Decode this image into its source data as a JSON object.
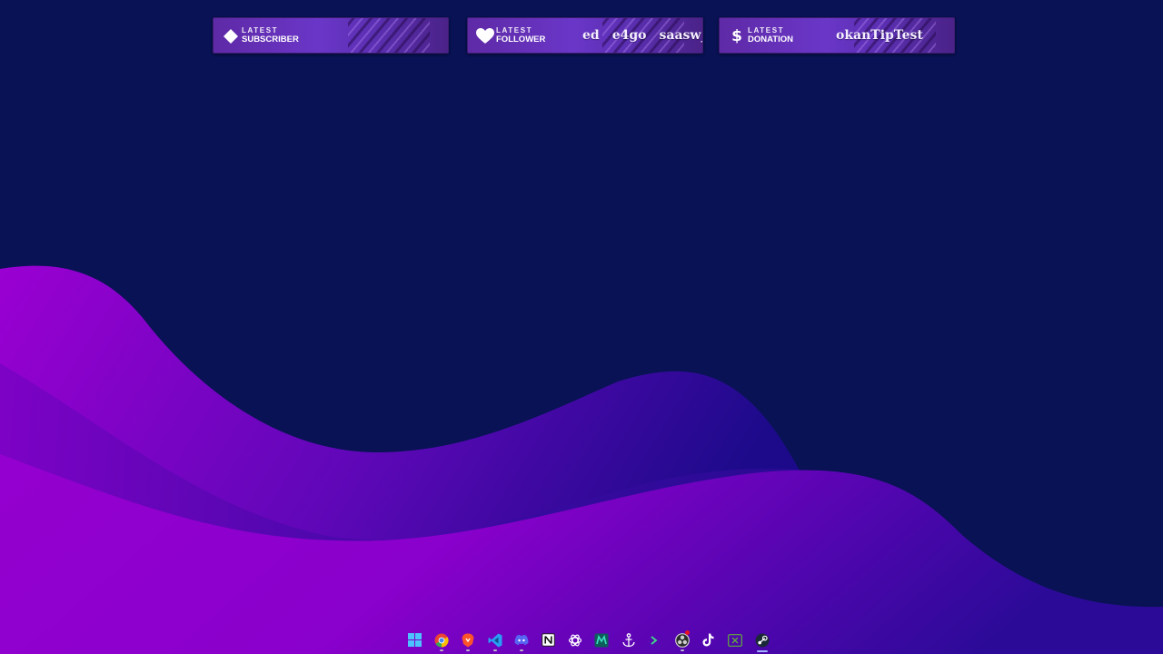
{
  "desktop": {
    "background_color": "#081254",
    "wave_colors": [
      "#8a00c8",
      "#5a06b4",
      "#2d0a96",
      "#9a00d6"
    ]
  },
  "widgets": [
    {
      "id": "subscriber",
      "icon": "diamond-icon",
      "label_top": "LATEST",
      "label_bottom": "SUBSCRIBER",
      "ticker": []
    },
    {
      "id": "follower",
      "icon": "heart-icon",
      "label_top": "LATEST",
      "label_bottom": "FOLLOWER",
      "ticker": [
        "ed",
        "e4go",
        "saasw_"
      ]
    },
    {
      "id": "donation",
      "icon": "dollar-icon",
      "label_top": "LATEST",
      "label_bottom": "DONATION",
      "ticker": [
        "okanTipTest"
      ]
    }
  ],
  "taskbar": {
    "apps": [
      {
        "name": "start",
        "icon": "windows-start-icon",
        "color": "#4cc2ff",
        "running": false
      },
      {
        "name": "chrome",
        "icon": "chrome-icon",
        "color": "#ea4335",
        "running": true
      },
      {
        "name": "brave",
        "icon": "brave-icon",
        "color": "#fb542b",
        "running": true
      },
      {
        "name": "vscode",
        "icon": "vscode-icon",
        "color": "#2a9df4",
        "running": true
      },
      {
        "name": "discord",
        "icon": "discord-icon",
        "color": "#5865f2",
        "running": true
      },
      {
        "name": "notion",
        "icon": "notion-icon",
        "color": "#ffffff",
        "running": false
      },
      {
        "name": "chatgpt",
        "icon": "chatgpt-icon",
        "color": "#ffffff",
        "running": false
      },
      {
        "name": "green-app",
        "icon": "teal-app-icon",
        "color": "#18b59a",
        "running": false
      },
      {
        "name": "anchor-app",
        "icon": "anchor-icon",
        "color": "#ffffff",
        "running": false
      },
      {
        "name": "terminal",
        "icon": "terminal-icon",
        "color": "#3ddc84",
        "running": false
      },
      {
        "name": "obs",
        "icon": "obs-icon",
        "color": "#cfcfcf",
        "running": true,
        "badge": true
      },
      {
        "name": "tiktok",
        "icon": "tiktok-icon",
        "color": "#ffffff",
        "running": false
      },
      {
        "name": "xbox-app",
        "icon": "xbox-icon",
        "color": "#5fae3a",
        "running": false
      },
      {
        "name": "steam",
        "icon": "steam-icon",
        "color": "#ffffff",
        "running": true,
        "active": true
      }
    ]
  }
}
